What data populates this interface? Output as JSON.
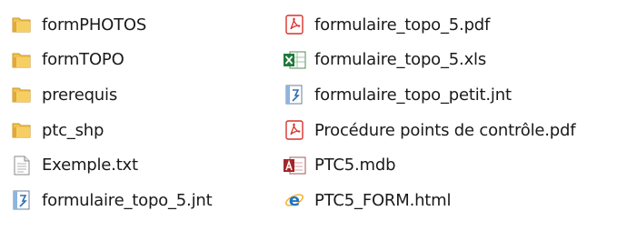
{
  "left_column": [
    {
      "name": "formPHOTOS",
      "icon": "folder-icon"
    },
    {
      "name": "formTOPO",
      "icon": "folder-icon"
    },
    {
      "name": "prerequis",
      "icon": "folder-icon"
    },
    {
      "name": "ptc_shp",
      "icon": "folder-icon"
    },
    {
      "name": "Exemple.txt",
      "icon": "text-file-icon"
    },
    {
      "name": "formulaire_topo_5.jnt",
      "icon": "journal-file-icon"
    }
  ],
  "right_column": [
    {
      "name": "formulaire_topo_5.pdf",
      "icon": "pdf-file-icon"
    },
    {
      "name": "formulaire_topo_5.xls",
      "icon": "excel-file-icon"
    },
    {
      "name": "formulaire_topo_petit.jnt",
      "icon": "journal-file-icon"
    },
    {
      "name": "Procédure points de contrôle.pdf",
      "icon": "pdf-file-icon"
    },
    {
      "name": "PTC5.mdb",
      "icon": "access-db-icon"
    },
    {
      "name": "PTC5_FORM.html",
      "icon": "internet-explorer-icon"
    }
  ],
  "colors": {
    "folder": "#e8b84a",
    "pdf": "#d9322b",
    "excel": "#1f7a3a",
    "access": "#a4262c",
    "ie": "#1e74c8"
  }
}
